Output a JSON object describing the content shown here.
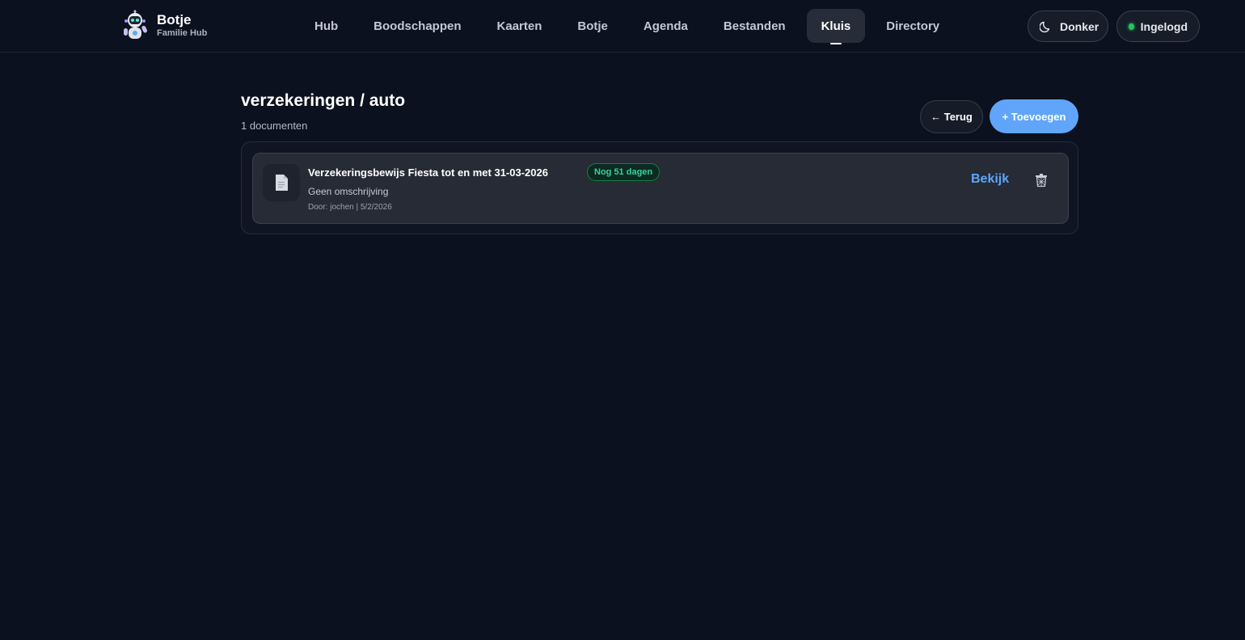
{
  "brand": {
    "title": "Botje",
    "subtitle": "Familie Hub"
  },
  "nav": {
    "items": [
      {
        "label": "Hub"
      },
      {
        "label": "Boodschappen"
      },
      {
        "label": "Kaarten"
      },
      {
        "label": "Botje"
      },
      {
        "label": "Agenda"
      },
      {
        "label": "Bestanden"
      },
      {
        "label": "Kluis",
        "active": true
      },
      {
        "label": "Directory"
      }
    ]
  },
  "header_actions": {
    "theme_label": "Donker",
    "status_label": "Ingelogd",
    "status_color": "#22c55e"
  },
  "page": {
    "title": "verzekeringen / auto",
    "count_text": "1 documenten",
    "back_label": "← Terug",
    "add_label": "+ Toevoegen"
  },
  "documents": [
    {
      "title": "Verzekeringsbewijs Fiesta tot en met 31-03-2026",
      "badge": "Nog 51 dagen",
      "description": "Geen omschrijving",
      "meta": "Door: jochen | 5/2/2026",
      "view_label": "Bekijk"
    }
  ],
  "colors": {
    "accent": "#60a5fa",
    "background": "#0b111e",
    "badge": "#34d399"
  },
  "icons": {
    "document": "document-icon",
    "delete": "trash-icon",
    "theme": "moon-icon",
    "logo": "robot-logo"
  }
}
